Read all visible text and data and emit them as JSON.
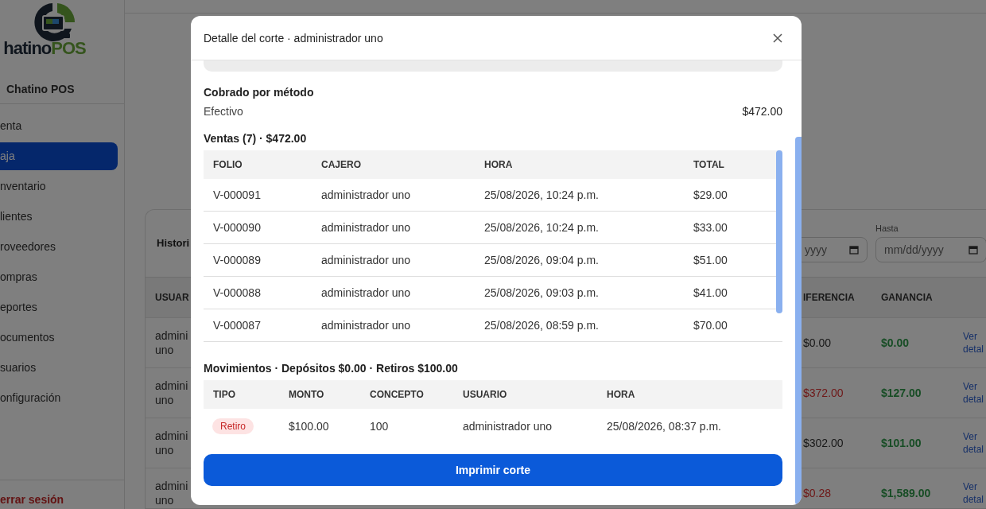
{
  "sidebar": {
    "logo_text": "hatino",
    "logo_accent": "POS",
    "brand": "Chatino POS",
    "items": [
      {
        "label": "enta",
        "selected": false
      },
      {
        "label": "aja",
        "selected": true
      },
      {
        "label": "nventario",
        "selected": false
      },
      {
        "label": "lientes",
        "selected": false
      },
      {
        "label": "roveedores",
        "selected": false
      },
      {
        "label": "ompras",
        "selected": false
      },
      {
        "label": "eportes",
        "selected": false
      },
      {
        "label": "ocumentos",
        "selected": false
      },
      {
        "label": "suarios",
        "selected": false
      },
      {
        "label": "onfiguración",
        "selected": false
      }
    ],
    "logout": "errar sesión"
  },
  "history": {
    "title": "Histori",
    "filters": [
      {
        "placeholder": "yyyy"
      },
      {
        "label": "Hasta",
        "placeholder": "mm/dd/yyyy"
      }
    ],
    "columns": [
      "USUAR",
      "IFERENCIA",
      "GANANCIA"
    ],
    "rows": [
      {
        "user": "admini uno",
        "difference": "$0.00",
        "negative": false,
        "profit": "$0.00",
        "link": "Ver detal"
      },
      {
        "user": "admini uno",
        "difference": "$372.00",
        "negative": true,
        "profit": "$127.00",
        "link": "Ver detal"
      },
      {
        "user": "admini uno",
        "difference": "$302.00",
        "negative": false,
        "profit": "$101.00",
        "link": "Ver detal"
      },
      {
        "user": "admini uno",
        "difference": "$0.28",
        "negative": true,
        "profit": "$1,589.00",
        "link": "Ver detal"
      }
    ]
  },
  "modal": {
    "title": "Detalle del corte · administrador uno",
    "methods_title": "Cobrado por método",
    "methods": [
      {
        "name": "Efectivo",
        "amount": "$472.00"
      }
    ],
    "sales_title": "Ventas (7) · $472.00",
    "sales_columns": [
      "FOLIO",
      "CAJERO",
      "HORA",
      "TOTAL"
    ],
    "sales": [
      {
        "folio": "V-000091",
        "cashier": "administrador uno",
        "time": "25/08/2026, 10:24 p.m.",
        "total": "$29.00"
      },
      {
        "folio": "V-000090",
        "cashier": "administrador uno",
        "time": "25/08/2026, 10:24 p.m.",
        "total": "$33.00"
      },
      {
        "folio": "V-000089",
        "cashier": "administrador uno",
        "time": "25/08/2026, 09:04 p.m.",
        "total": "$51.00"
      },
      {
        "folio": "V-000088",
        "cashier": "administrador uno",
        "time": "25/08/2026, 09:03 p.m.",
        "total": "$41.00"
      },
      {
        "folio": "V-000087",
        "cashier": "administrador uno",
        "time": "25/08/2026, 08:59 p.m.",
        "total": "$70.00"
      }
    ],
    "movements_title": "Movimientos · Depósitos $0.00 · Retiros $100.00",
    "movement_columns": [
      "TIPO",
      "MONTO",
      "CONCEPTO",
      "USUARIO",
      "HORA"
    ],
    "movements": [
      {
        "kind": "withdrawal",
        "type": "Retiro",
        "amount": "$100.00",
        "concept": "100",
        "user": "administrador uno",
        "time": "25/08/2026, 08:37 p.m."
      }
    ],
    "print_button": "Imprimir corte"
  }
}
